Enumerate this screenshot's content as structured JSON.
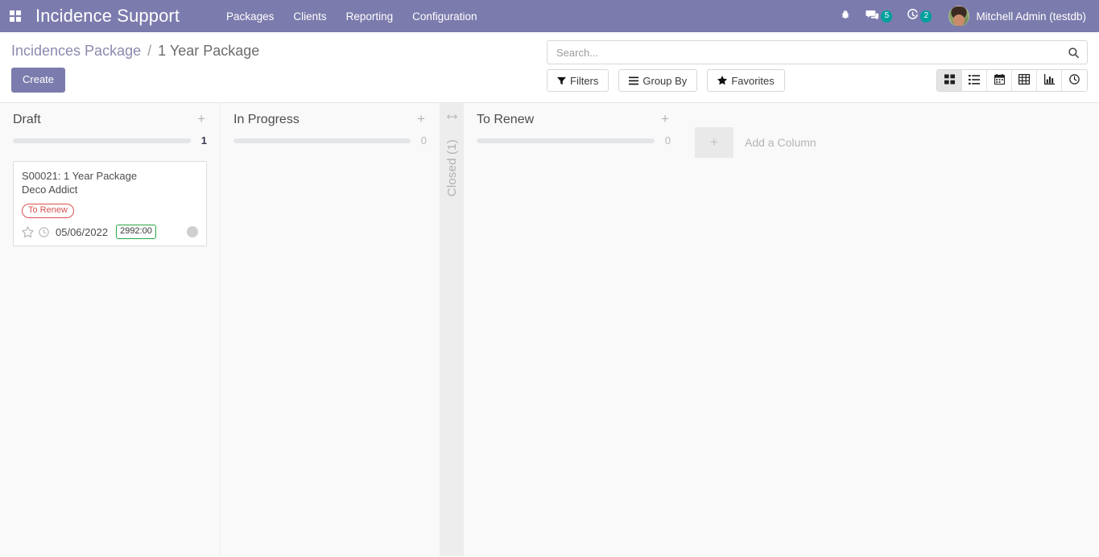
{
  "navbar": {
    "apps_menu_icon": "apps-grid-icon",
    "brand_title": "Incidence Support",
    "menu_items": [
      {
        "label": "Packages"
      },
      {
        "label": "Clients"
      },
      {
        "label": "Reporting"
      },
      {
        "label": "Configuration"
      }
    ],
    "systray": [
      {
        "icon": "bug-icon",
        "badge": ""
      },
      {
        "icon": "messages-icon",
        "badge": "5"
      },
      {
        "icon": "activity-clock-icon",
        "badge": "2"
      }
    ],
    "user": {
      "avatar_icon": "user-avatar",
      "name": "Mitchell Admin (testdb)"
    },
    "brand_color": "#7c7bad",
    "badge_color": "#00a09d"
  },
  "control_panel": {
    "breadcrumb": {
      "parent": "Incidences Package",
      "separator": "/",
      "current": "1 Year Package"
    },
    "create_label": "Create",
    "search": {
      "placeholder": "Search...",
      "value": "",
      "icon": "search-icon"
    },
    "filter_buttons": [
      {
        "label": "Filters",
        "icon": "filter-funnel-icon"
      },
      {
        "label": "Group By",
        "icon": "group-by-lines-icon"
      },
      {
        "label": "Favorites",
        "icon": "star-icon"
      }
    ],
    "views": [
      {
        "name": "kanban",
        "icon": "kanban-grid-icon",
        "active": true
      },
      {
        "name": "list",
        "icon": "list-icon",
        "active": false
      },
      {
        "name": "calendar",
        "icon": "calendar-icon",
        "active": false
      },
      {
        "name": "pivot",
        "icon": "pivot-table-icon",
        "active": false
      },
      {
        "name": "graph",
        "icon": "bar-chart-icon",
        "active": false
      },
      {
        "name": "activity",
        "icon": "clock-icon",
        "active": false
      }
    ]
  },
  "kanban": {
    "columns": [
      {
        "title": "Draft",
        "count": "1",
        "add_icon": "plus-icon",
        "cards": [
          {
            "title": "S00021: 1 Year Package",
            "subtitle": "Deco Addict",
            "tag": "To Renew",
            "tag_color": "#d9534f",
            "date": "05/06/2022",
            "hours": "2992:00",
            "hours_color": "#28a745",
            "priority_icon": "star-icon",
            "clock_icon": "clock-icon",
            "avatar_icon": "assignee-avatar"
          }
        ]
      },
      {
        "title": "In Progress",
        "count": "0",
        "add_icon": "plus-icon",
        "cards": []
      },
      {
        "title": "To Renew",
        "count": "0",
        "add_icon": "plus-icon",
        "cards": []
      }
    ],
    "folded_column": {
      "label": "Closed (1)",
      "arrow_icon": "arrows-horizontal-icon"
    },
    "add_column": {
      "label": "Add a Column",
      "icon": "plus-icon"
    }
  }
}
